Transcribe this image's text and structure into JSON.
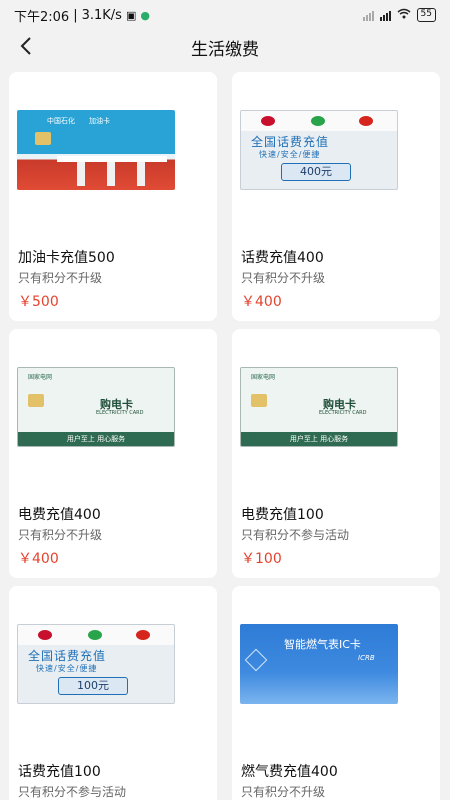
{
  "status_bar": {
    "time": "下午2:06",
    "speed": "3.1K/s",
    "battery": "55"
  },
  "header": {
    "title": "生活缴费"
  },
  "cards": [
    {
      "title": "加油卡充值500",
      "subtitle": "只有积分不升级",
      "price": "￥500",
      "image": "fuel-card",
      "image_text": [
        "中国石化",
        "加油卡"
      ]
    },
    {
      "title": "话费充值400",
      "subtitle": "只有积分不升级",
      "price": "￥400",
      "image": "phone-card",
      "image_text": [
        "全国话费充值",
        "快速/安全/便捷",
        "400元"
      ]
    },
    {
      "title": "电费充值400",
      "subtitle": "只有积分不升级",
      "price": "￥400",
      "image": "electricity-card",
      "image_text": [
        "国家电网",
        "购电卡",
        "ELECTRICITY CARD",
        "用户至上  用心服务"
      ]
    },
    {
      "title": "电费充值100",
      "subtitle": "只有积分不参与活动",
      "price": "￥100",
      "image": "electricity-card",
      "image_text": [
        "国家电网",
        "购电卡",
        "ELECTRICITY CARD",
        "用户至上  用心服务"
      ]
    },
    {
      "title": "话费充值100",
      "subtitle": "只有积分不参与活动",
      "price": "",
      "image": "phone-card",
      "image_text": [
        "全国话费充值",
        "快速/安全/便捷",
        "100元"
      ]
    },
    {
      "title": "燃气费充值400",
      "subtitle": "只有积分不升级",
      "price": "",
      "image": "gas-card",
      "image_text": [
        "智能燃气表IC卡",
        "ICRB"
      ]
    }
  ],
  "colors": {
    "price": "#e5432e",
    "background": "#f2f2f2"
  }
}
